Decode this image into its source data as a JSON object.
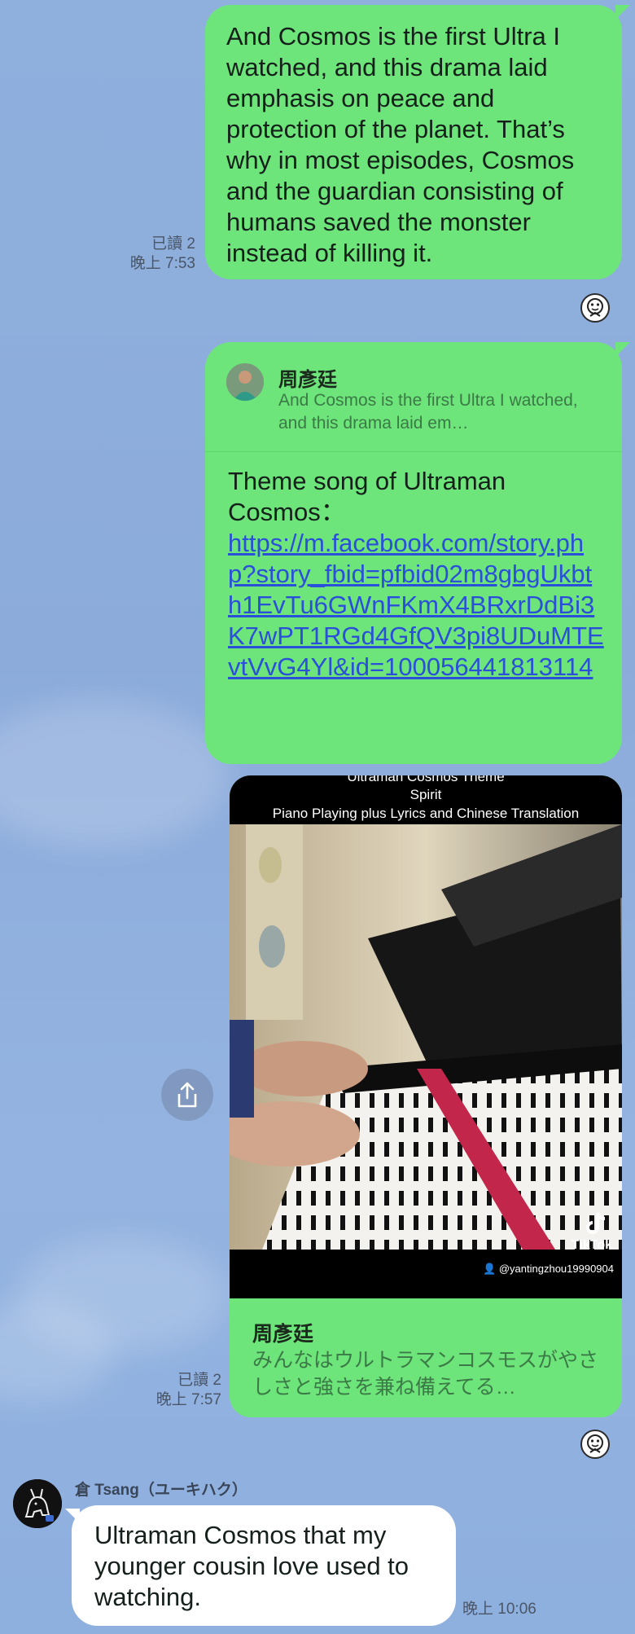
{
  "messages": {
    "m1": {
      "text": "And Cosmos is the first Ultra I watched, and this drama laid emphasis on peace and protection of the planet. That’s why in most episodes, Cosmos and the guardian consisting of humans saved the monster instead of killing it.",
      "read": "已讀 2",
      "time": "晚上 7:53"
    },
    "m2": {
      "reply_name": "周彥廷",
      "reply_snippet": "And Cosmos is the first Ultra I watched, and this drama laid em…",
      "body_text": "Theme song of Ultraman Cosmos：",
      "link": "https://m.facebook.com/story.php?story_fbid=pfbid02m8gbgUkbth1EvTu6GWnFKmX4BRxrDdBi3K7wPT1RGd4GfQV3pi8UDuMTEvtVvG4Yl&id=100056441813114"
    },
    "m3": {
      "video_cut_title": "Ultraman Cosmos Theme",
      "video_title": "Spirit",
      "video_subtitle": "Piano Playing plus Lyrics and Chinese Translation",
      "tiktok_label": "TikTok",
      "tiktok_user": "@yantingzhou19990904",
      "name": "周彥廷",
      "preview": "みんなはウルトラマンコスモスがやさしさと強さを兼ね備えてる…",
      "read": "已讀 2",
      "time": "晚上 7:57"
    },
    "m4": {
      "sender": "倉 Tsang（ユーキハク）",
      "text": "Ultraman Cosmos that my younger cousin love used to watching.",
      "time": "晚上 10:06"
    }
  },
  "icons": {
    "share": "share-icon",
    "read_avatar": "read-receipt-avatar",
    "sender_avatar": "dog-avatar"
  },
  "colors": {
    "outgoing_bubble": "#6de57b",
    "incoming_bubble": "#ffffff",
    "link": "#2a4fd8",
    "background": "#8fb0dd"
  }
}
